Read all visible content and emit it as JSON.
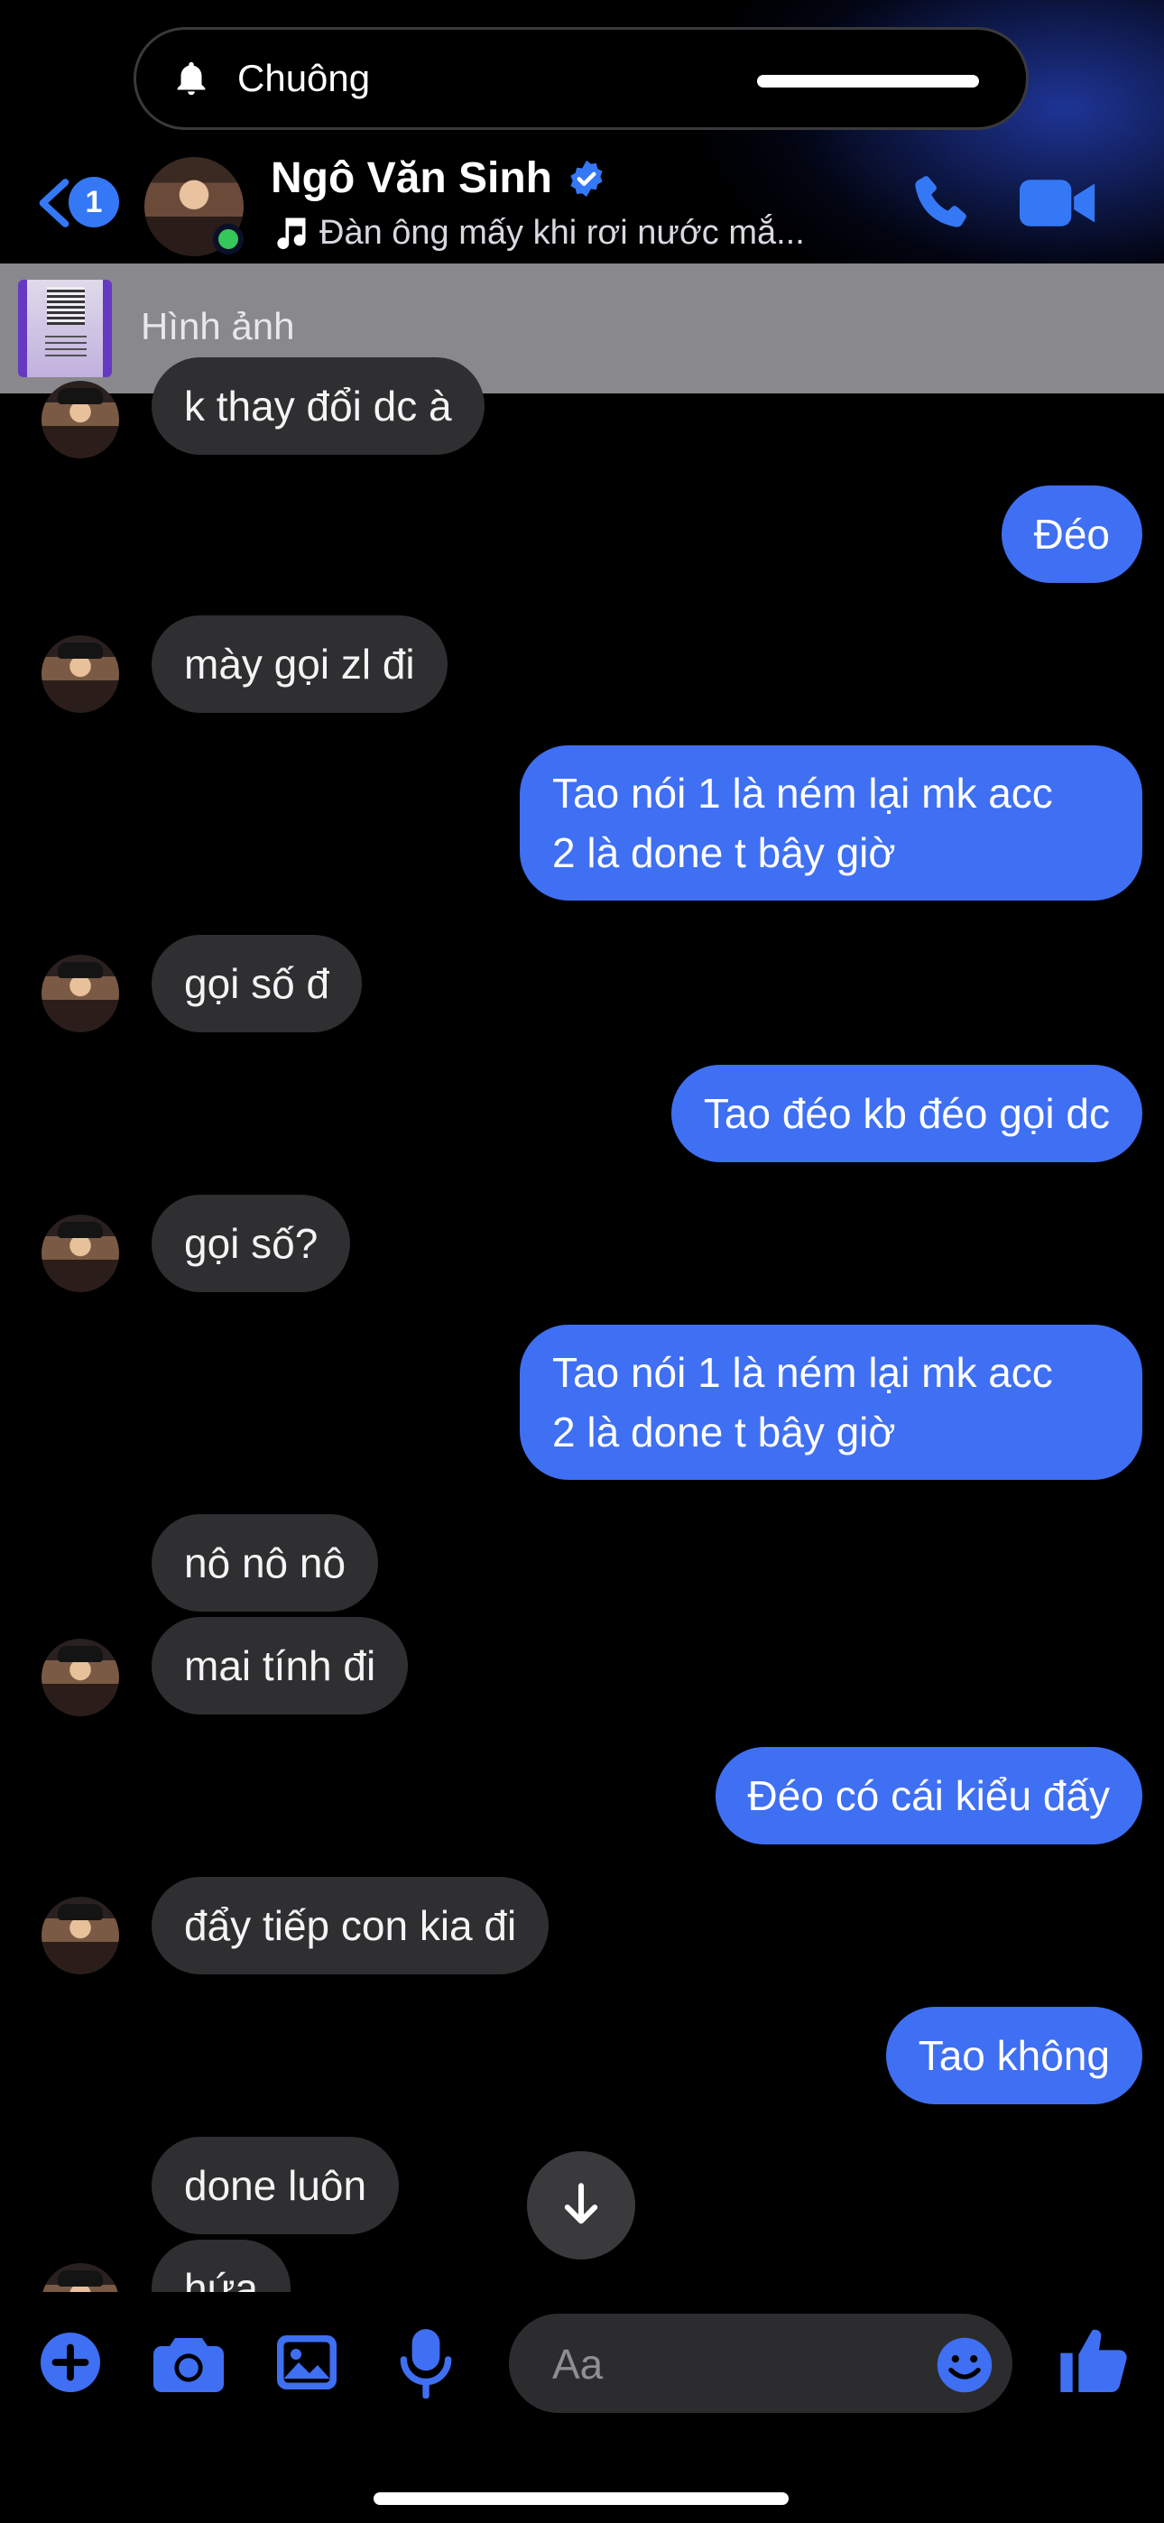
{
  "notification": {
    "label": "Chuông"
  },
  "header": {
    "unread_count": "1",
    "contact_name": "Ngô Văn Sinh",
    "status_text": "Đàn ông mấy khi rơi nước mắ..."
  },
  "pinned": {
    "label": "Hình ảnh"
  },
  "messages": [
    {
      "side": "in",
      "text": "k thay đổi dc à"
    },
    {
      "side": "out",
      "text": "Đéo"
    },
    {
      "side": "in",
      "text": "mày gọi zl đi"
    },
    {
      "side": "out",
      "lines": [
        "Tao nói 1 là ném lại mk acc",
        "2 là done t bây giờ"
      ]
    },
    {
      "side": "in",
      "text": "gọi số đ"
    },
    {
      "side": "out",
      "text": "Tao đéo kb đéo gọi dc"
    },
    {
      "side": "in",
      "text": "gọi số?"
    },
    {
      "side": "out",
      "lines": [
        "Tao nói 1 là ném lại mk acc",
        "2 là done t bây giờ"
      ]
    },
    {
      "side": "in",
      "text": "nô nô nô"
    },
    {
      "side": "in",
      "text": "mai tính đi"
    },
    {
      "side": "out",
      "text": "Đéo có cái kiểu đấy"
    },
    {
      "side": "in",
      "text": "đẩy tiếp con kia đi"
    },
    {
      "side": "out",
      "text": "Tao không"
    },
    {
      "side": "in",
      "text": "done luôn"
    },
    {
      "side": "in",
      "text": "hứa"
    }
  ],
  "composer": {
    "placeholder": "Aa"
  },
  "colors": {
    "accent": "#3f6ff2",
    "incoming_bubble": "#2f2f31",
    "background": "#000000"
  },
  "icons": [
    "bell-icon",
    "back-chevron-icon",
    "verified-badge-icon",
    "music-note-icon",
    "phone-icon",
    "video-camera-icon",
    "arrow-down-icon",
    "plus-icon",
    "camera-icon",
    "image-icon",
    "microphone-icon",
    "emoji-icon",
    "thumbs-up-icon"
  ]
}
